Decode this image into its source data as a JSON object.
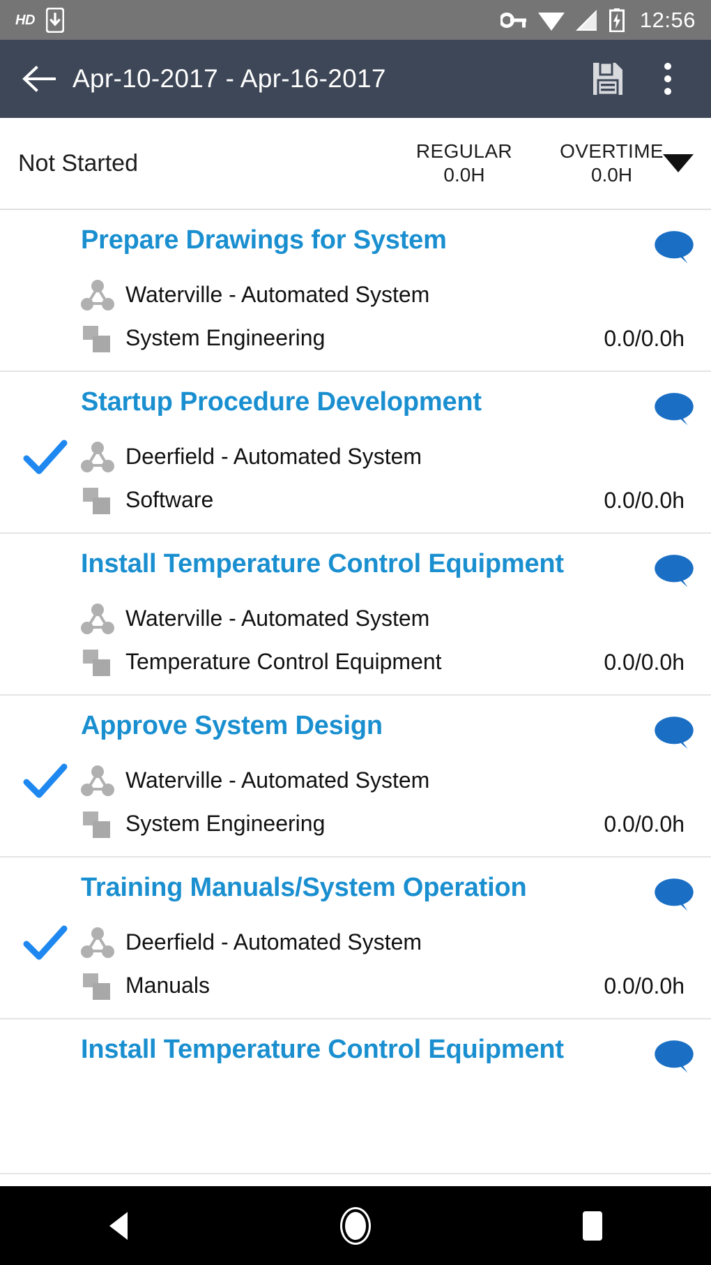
{
  "status_bar": {
    "hd_label": "HD",
    "time": "12:56",
    "icons": [
      "hd-label",
      "download-icon",
      "vpn-key-icon",
      "wifi-icon",
      "signal-icon",
      "battery-charging-icon"
    ],
    "background_color": "#757575"
  },
  "app_bar": {
    "title": "Apr-10-2017  -  Apr-16-2017",
    "back_label": "Back",
    "save_label": "Save",
    "overflow_label": "More options",
    "background_color": "#3e4757"
  },
  "summary": {
    "status": "Not Started",
    "metrics": [
      {
        "label": "REGULAR",
        "value": "0.0H"
      },
      {
        "label": "OVERTIME",
        "value": "0.0H"
      }
    ],
    "dropdown_label": "Expand"
  },
  "accent_color": "#1a8fd0",
  "check_color": "#1e88f0",
  "tasks": [
    {
      "title": "Prepare Drawings for System",
      "project": "Waterville - Automated System",
      "category": "System Engineering",
      "hours": "0.0/0.0h",
      "checked": false,
      "has_comment": true
    },
    {
      "title": "Startup Procedure Development",
      "project": "Deerfield - Automated System",
      "category": "Software",
      "hours": "0.0/0.0h",
      "checked": true,
      "has_comment": true
    },
    {
      "title": "Install Temperature Control Equipment",
      "project": "Waterville - Automated System",
      "category": "Temperature Control Equipment",
      "hours": "0.0/0.0h",
      "checked": false,
      "has_comment": true
    },
    {
      "title": "Approve System Design",
      "project": "Waterville - Automated System",
      "category": "System Engineering",
      "hours": "0.0/0.0h",
      "checked": true,
      "has_comment": true
    },
    {
      "title": "Training Manuals/System Operation",
      "project": "Deerfield - Automated System",
      "category": "Manuals",
      "hours": "0.0/0.0h",
      "checked": true,
      "has_comment": true
    },
    {
      "title": "Install Temperature Control Equipment",
      "project": "",
      "category": "",
      "hours": "",
      "checked": false,
      "has_comment": true
    }
  ],
  "nav_bar": {
    "back_label": "Back",
    "home_label": "Home",
    "recents_label": "Recents"
  }
}
